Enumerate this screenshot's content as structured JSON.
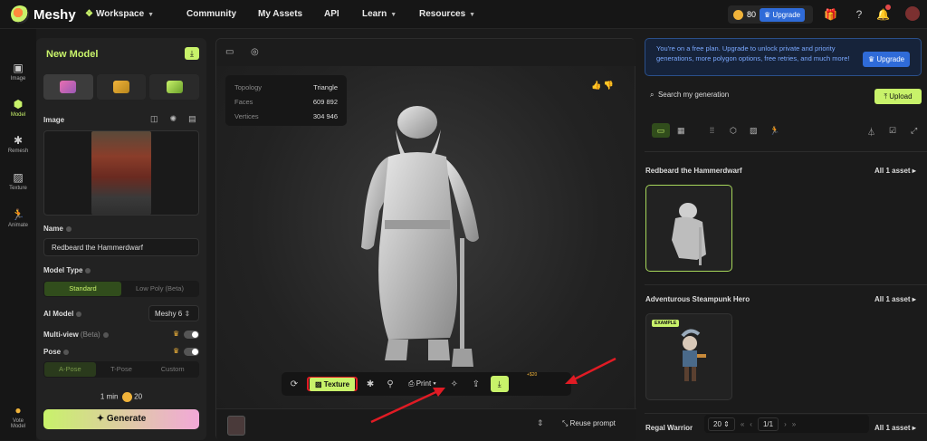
{
  "topbar": {
    "logo": "Meshy",
    "nav": {
      "workspace": "Workspace",
      "community": "Community",
      "my_assets": "My Assets",
      "api": "API",
      "learn": "Learn",
      "resources": "Resources"
    },
    "credits": "80",
    "upgrade": "Upgrade",
    "notifications_count": "2"
  },
  "leftnav": {
    "items": [
      {
        "label": "Image",
        "icon": "image-icon"
      },
      {
        "label": "Model",
        "icon": "cube-icon"
      },
      {
        "label": "Remesh",
        "icon": "remesh-icon"
      },
      {
        "label": "Texture",
        "icon": "texture-icon"
      },
      {
        "label": "Animate",
        "icon": "running-man-icon"
      },
      {
        "label_line1": "Vote",
        "label_line2": "Model",
        "icon": "vote-icon"
      }
    ]
  },
  "panel": {
    "title": "New Model",
    "image_label": "Image",
    "name_label": "Name",
    "name_value": "Redbeard the Hammerdwarf",
    "model_type_label": "Model Type",
    "model_type_options": [
      "Standard",
      "Low Poly (Beta)"
    ],
    "model_type_selected": "Standard",
    "ai_model_label": "AI Model",
    "ai_model_value": "Meshy 6",
    "multiview_label": "Multi-view",
    "multiview_beta": "(Beta)",
    "pose_label": "Pose",
    "pose_options": [
      "A-Pose",
      "T-Pose",
      "Custom"
    ],
    "pose_selected": "A-Pose",
    "time": "1 min",
    "cost": "20",
    "generate": "Generate"
  },
  "viewer": {
    "stats": [
      {
        "key": "Topology",
        "value": "Triangle"
      },
      {
        "key": "Faces",
        "value": "609 892"
      },
      {
        "key": "Vertices",
        "value": "304 946"
      }
    ],
    "toolbar": {
      "texture": "Texture",
      "print": "Print",
      "extra_cost": "+$20"
    },
    "reuse_prompt": "Reuse prompt"
  },
  "right": {
    "banner_text": "You're on a free plan. Upgrade to unlock private and priority generations, more polygon options, free retries, and much more!",
    "banner_button": "Upgrade",
    "search_placeholder": "Search my generation",
    "upload": "Upload",
    "sections": [
      {
        "title": "Redbeard the Hammerdwarf",
        "all": "All 1 asset"
      },
      {
        "title": "Adventurous Steampunk Hero",
        "all": "All 1 asset",
        "badge": "EXAMPLE"
      },
      {
        "title": "Regal Warrior",
        "all": "All 1 asset"
      }
    ],
    "pager": {
      "per_page": "20",
      "page": "1/1"
    }
  },
  "colors": {
    "accent": "#c8f26a",
    "highlight": "#e01b24",
    "arrow": "#e01b24",
    "upgrade": "#2f6bd8"
  }
}
